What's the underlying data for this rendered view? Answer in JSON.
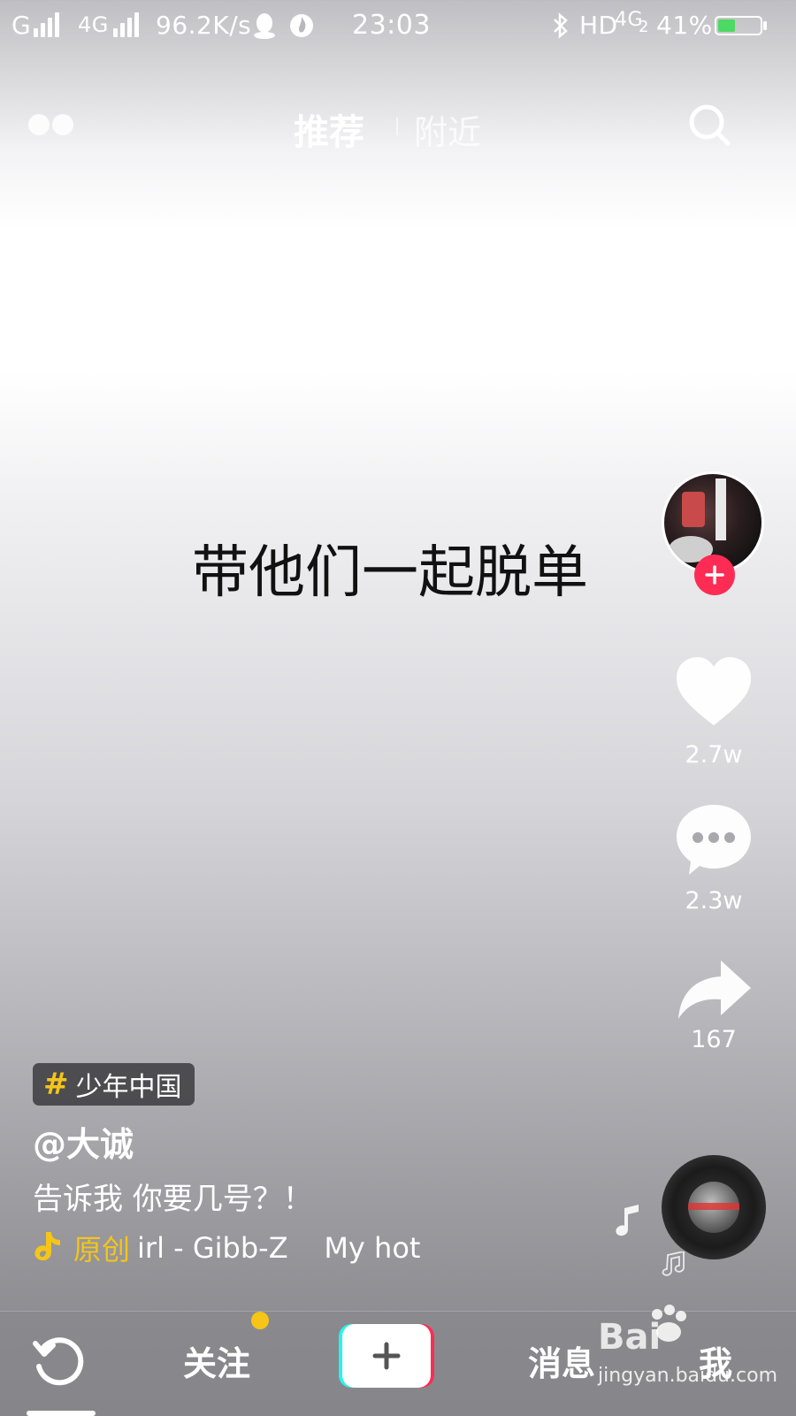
{
  "status_bar": {
    "carrier1": "G",
    "network_type": "4G",
    "speed": "96.2K/s",
    "time": "23:03",
    "hd": "HD",
    "network_type2": "4G",
    "network_sub": "2",
    "battery_percent": "41%",
    "battery_level": 0.41
  },
  "top_nav": {
    "tab_recommend": "推荐",
    "tab_nearby": "附近"
  },
  "video": {
    "caption_overlay": "带他们一起脱单"
  },
  "side_actions": {
    "like_count": "2.7w",
    "comment_count": "2.3w",
    "share_count": "167"
  },
  "post": {
    "hashtag": "少年中国",
    "author": "@大诚",
    "description": "告诉我 你要几号？！",
    "music_tag": "原创",
    "music_text": "irl - Gibb-Z    My hot"
  },
  "bottom_nav": {
    "follow_label": "关注",
    "messages_label": "消息",
    "me_label": "我"
  },
  "watermark": {
    "brand": "Bai",
    "site": "jingyan.baidu.com"
  },
  "colors": {
    "accent_red": "#fe2c55",
    "accent_cyan": "#25f4ee",
    "hashtag_yellow": "#f5c518",
    "notify_dot": "#f5c518"
  }
}
